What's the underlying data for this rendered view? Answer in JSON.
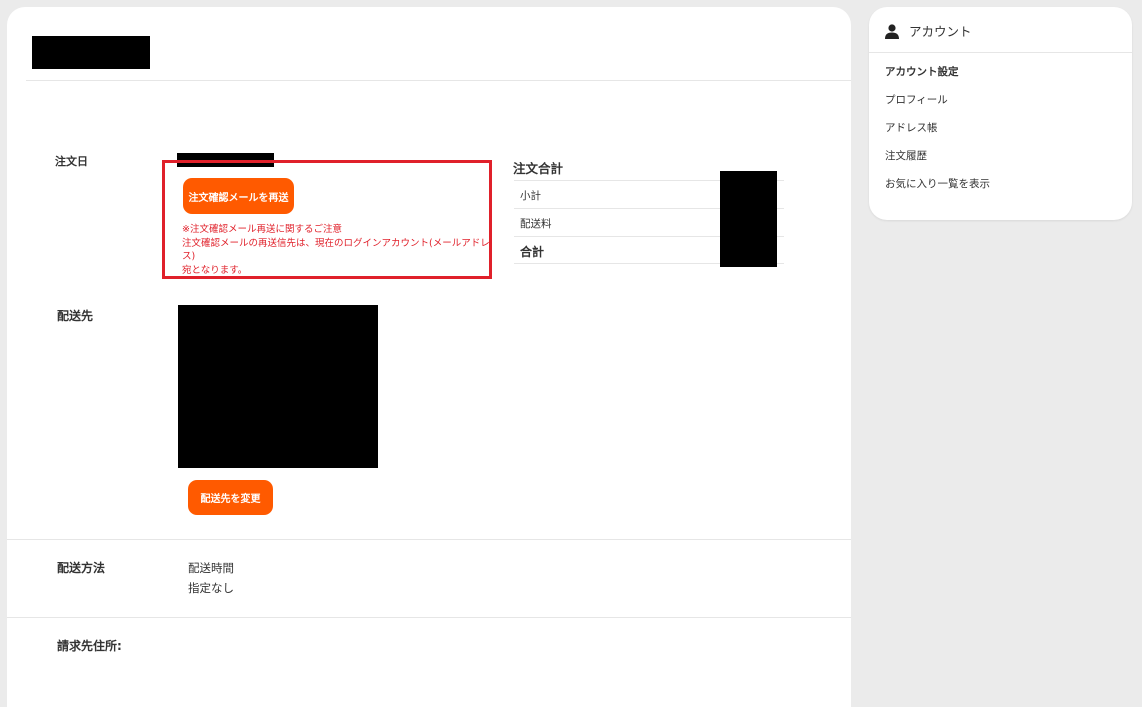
{
  "order": {
    "date_label": "注文日",
    "resend_button_label": "注文確認メールを再送",
    "notice_lines": [
      "※注文確認メール再送に関するご注意",
      "注文確認メールの再送信先は、現在のログインアカウント(メールアドレス)",
      "宛となります。"
    ],
    "shipping_label": "配送先",
    "change_address_button_label": "配送先を変更",
    "delivery_method_label": "配送方法",
    "delivery_time_label": "配送時間",
    "delivery_time_value": "指定なし",
    "billing_label": "請求先住所:"
  },
  "summary": {
    "title": "注文合計",
    "subtotal_label": "小計",
    "shipping_fee_label": "配送料",
    "total_label": "合計"
  },
  "sidebar": {
    "title": "アカウント",
    "section_title": "アカウント設定",
    "items": [
      {
        "label": "プロフィール"
      },
      {
        "label": "アドレス帳"
      },
      {
        "label": "注文履歴"
      },
      {
        "label": "お気に入り一覧を表示"
      }
    ]
  },
  "colors": {
    "accent": "#ff5a00",
    "highlight": "#e0202a"
  }
}
